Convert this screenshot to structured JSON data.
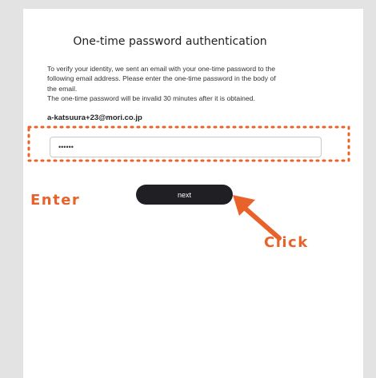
{
  "page": {
    "title": "One-time password authentication",
    "description_lines": [
      "To verify your identity, we sent an email with your one-time password to the",
      "following email address. Please enter the one-time password in the body of",
      "the email.",
      "The one-time password will be invalid 30 minutes after it is obtained."
    ],
    "email": "a-katsuura+23@mori.co.jp"
  },
  "form": {
    "otp_value": "••••••",
    "next_label": "next"
  },
  "annotations": {
    "enter_label": "Enter",
    "click_label": "Click",
    "accent_color": "#e8622a"
  }
}
